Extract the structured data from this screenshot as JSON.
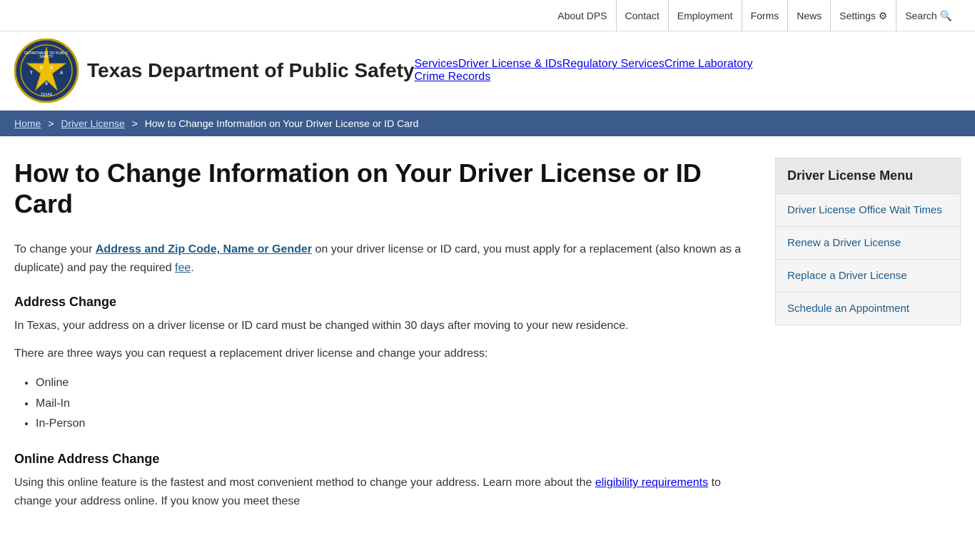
{
  "utility_bar": {
    "links": [
      {
        "label": "About DPS",
        "name": "about-dps-link"
      },
      {
        "label": "Contact",
        "name": "contact-link"
      },
      {
        "label": "Employment",
        "name": "employment-link"
      },
      {
        "label": "Forms",
        "name": "forms-link"
      },
      {
        "label": "News",
        "name": "news-link"
      },
      {
        "label": "Settings",
        "name": "settings-link"
      },
      {
        "label": "Search",
        "name": "search-link"
      }
    ]
  },
  "header": {
    "logo_text": "Texas Department of Public Safety",
    "nav_items_row1": [
      {
        "label": "Services",
        "name": "nav-services"
      },
      {
        "label": "Driver License & IDs",
        "name": "nav-driver-license"
      },
      {
        "label": "Regulatory Services",
        "name": "nav-regulatory"
      },
      {
        "label": "Crime Laboratory",
        "name": "nav-crime-lab"
      }
    ],
    "nav_items_row2": [
      {
        "label": "Crime Records",
        "name": "nav-crime-records"
      }
    ]
  },
  "breadcrumb": {
    "home_label": "Home",
    "driver_license_label": "Driver License",
    "current_label": "How to Change Information on Your Driver License or ID Card"
  },
  "page": {
    "title": "How to Change Information on Your Driver License or ID Card",
    "intro": {
      "before_link": "To change your ",
      "link_text": "Address and Zip Code, Name or Gender",
      "after_link": " on your driver license or ID card, you must apply for a replacement (also known as a duplicate) and pay the required ",
      "fee_link": "fee",
      "end": "."
    },
    "sections": [
      {
        "heading": "Address Change",
        "paragraphs": [
          "In Texas, your address on a driver license or ID card must be changed within 30 days after moving to your new residence.",
          "There are three ways you can request a replacement driver license and change your address:"
        ],
        "bullets": [
          "Online",
          "Mail-In",
          "In-Person"
        ]
      },
      {
        "heading": "Online Address Change",
        "paragraphs": [
          "Using this online feature is the fastest and most convenient method to change your address. Learn more about the ",
          "eligibility requirements",
          " to change your address online. If you know you meet these"
        ]
      }
    ]
  },
  "sidebar": {
    "menu_title": "Driver License Menu",
    "items": [
      {
        "label": "Driver License Office Wait Times",
        "name": "sidebar-wait-times"
      },
      {
        "label": "Renew a Driver License",
        "name": "sidebar-renew"
      },
      {
        "label": "Replace a Driver License",
        "name": "sidebar-replace"
      },
      {
        "label": "Schedule an Appointment",
        "name": "sidebar-appointment"
      }
    ]
  }
}
